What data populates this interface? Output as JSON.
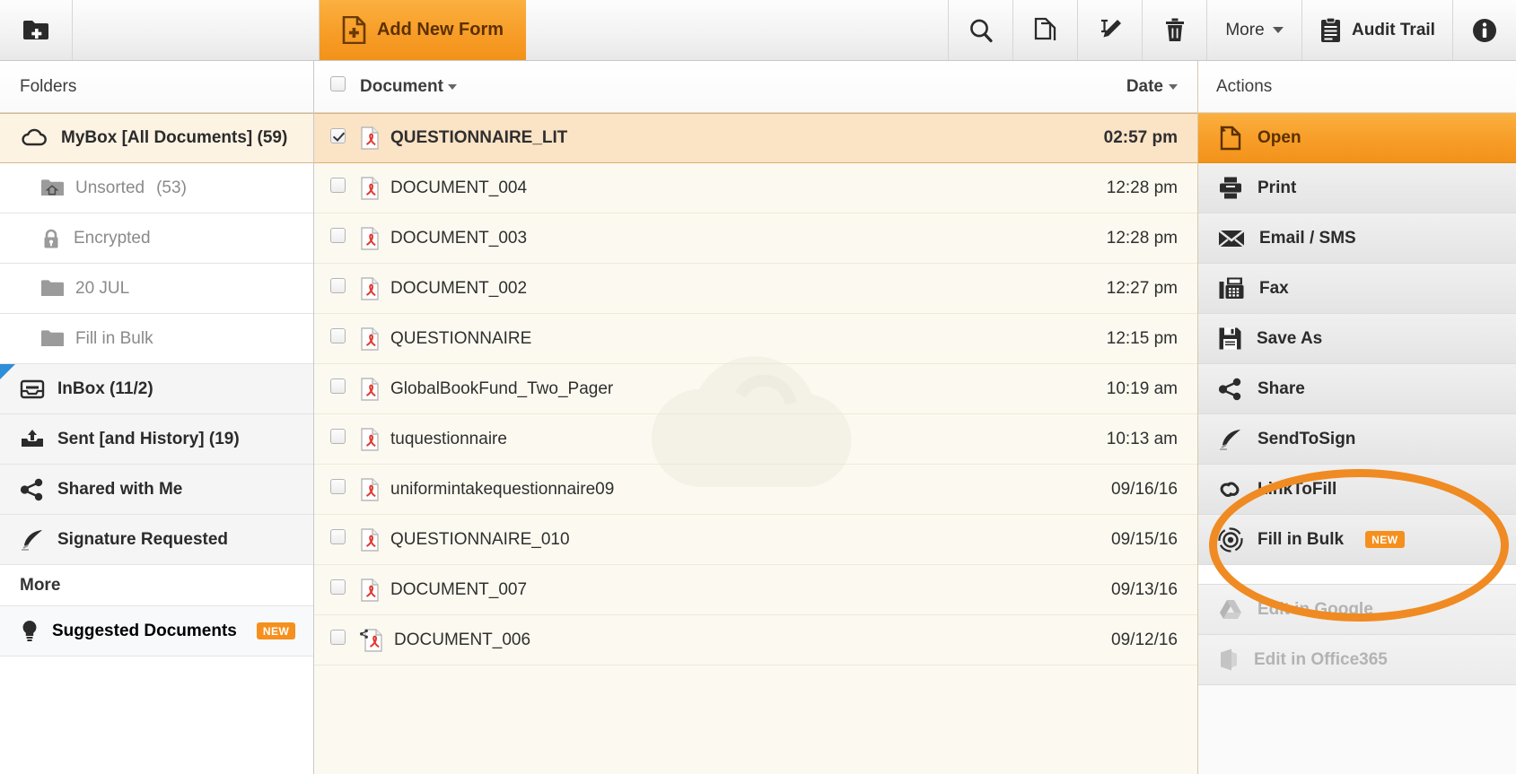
{
  "toolbar": {
    "new_folder_label": "New Folder",
    "new_folder_icon": "folder-plus-icon",
    "add_new_form_label": "Add New Form",
    "add_new_form_icon": "document-plus-icon",
    "search_icon": "search-icon",
    "copy_icon": "copy-icon",
    "rename_icon": "rename-pencil-icon",
    "delete_icon": "trash-icon",
    "more_label": "More",
    "more_icon": "chevron-down-icon",
    "audit_trail_label": "Audit Trail",
    "audit_trail_icon": "clipboard-icon",
    "info_icon": "info-icon"
  },
  "sidebar": {
    "header": "Folders",
    "items": [
      {
        "label": "MyBox [All Documents] (59)",
        "icon": "cloud-icon",
        "type": "root",
        "selected": true
      },
      {
        "label": "Unsorted",
        "count": "(53)",
        "icon": "folder-home-icon",
        "type": "sub"
      },
      {
        "label": "Encrypted",
        "count": "",
        "icon": "lock-icon",
        "type": "sub"
      },
      {
        "label": "20 JUL",
        "count": "",
        "icon": "folder-icon",
        "type": "sub"
      },
      {
        "label": "Fill in Bulk",
        "count": "",
        "icon": "folder-icon",
        "type": "sub"
      },
      {
        "label": "InBox (11/2)",
        "icon": "inbox-icon",
        "type": "group",
        "marked": true
      },
      {
        "label": "Sent [and History] (19)",
        "icon": "outbox-icon",
        "type": "group"
      },
      {
        "label": "Shared with Me",
        "icon": "share-icon",
        "type": "group"
      },
      {
        "label": "Signature Requested",
        "icon": "feather-icon",
        "type": "group"
      }
    ],
    "more_label": "More",
    "suggested": {
      "label": "Suggested Documents",
      "icon": "lightbulb-icon",
      "badge": "NEW"
    }
  },
  "doclist": {
    "columns": {
      "document": "Document",
      "date": "Date"
    },
    "select_all_checked": false,
    "sort_indicator": "descending",
    "rows": [
      {
        "name": "QUESTIONNAIRE_LIT",
        "date": "02:57 pm",
        "checked": true,
        "selected": true,
        "icon": "pdf-icon",
        "shared": false
      },
      {
        "name": "DOCUMENT_004",
        "date": "12:28 pm",
        "checked": false,
        "selected": false,
        "icon": "pdf-icon",
        "shared": false
      },
      {
        "name": "DOCUMENT_003",
        "date": "12:28 pm",
        "checked": false,
        "selected": false,
        "icon": "pdf-icon",
        "shared": false
      },
      {
        "name": "DOCUMENT_002",
        "date": "12:27 pm",
        "checked": false,
        "selected": false,
        "icon": "pdf-icon",
        "shared": false
      },
      {
        "name": "QUESTIONNAIRE",
        "date": "12:15 pm",
        "checked": false,
        "selected": false,
        "icon": "pdf-icon",
        "shared": false
      },
      {
        "name": "GlobalBookFund_Two_Pager",
        "date": "10:19 am",
        "checked": false,
        "selected": false,
        "icon": "pdf-icon",
        "shared": false
      },
      {
        "name": "tuquestionnaire",
        "date": "10:13 am",
        "checked": false,
        "selected": false,
        "icon": "pdf-icon",
        "shared": false
      },
      {
        "name": "uniformintakequestionnaire09",
        "date": "09/16/16",
        "checked": false,
        "selected": false,
        "icon": "pdf-icon",
        "shared": false
      },
      {
        "name": "QUESTIONNAIRE_010",
        "date": "09/15/16",
        "checked": false,
        "selected": false,
        "icon": "pdf-icon",
        "shared": false
      },
      {
        "name": "DOCUMENT_007",
        "date": "09/13/16",
        "checked": false,
        "selected": false,
        "icon": "pdf-icon",
        "shared": false
      },
      {
        "name": "DOCUMENT_006",
        "date": "09/12/16",
        "checked": false,
        "selected": false,
        "icon": "pdf-icon",
        "shared": true
      }
    ],
    "watermark_icon": "cloud-watermark"
  },
  "actions": {
    "header": "Actions",
    "items": [
      {
        "label": "Open",
        "icon": "open-document-icon",
        "state": "active"
      },
      {
        "label": "Print",
        "icon": "printer-icon",
        "state": "normal"
      },
      {
        "label": "Email / SMS",
        "icon": "envelope-icon",
        "state": "normal"
      },
      {
        "label": "Fax",
        "icon": "fax-icon",
        "state": "normal"
      },
      {
        "label": "Save As",
        "icon": "floppy-disk-icon",
        "state": "normal"
      },
      {
        "label": "Share",
        "icon": "share-icon",
        "state": "normal"
      },
      {
        "label": "SendToSign",
        "icon": "feather-icon",
        "state": "normal"
      },
      {
        "label": "LinkToFill",
        "icon": "link-icon",
        "state": "normal"
      },
      {
        "label": "Fill in Bulk",
        "icon": "bulk-gear-icon",
        "state": "normal",
        "badge": "NEW"
      },
      {
        "label": "Edit in Google",
        "icon": "google-drive-icon",
        "state": "disabled"
      },
      {
        "label": "Edit in Office365",
        "icon": "office-icon",
        "state": "disabled"
      }
    ],
    "highlight": {
      "shape": "ellipse",
      "color": "#ef8b22"
    }
  },
  "colors": {
    "accent_orange": "#f5901e",
    "selected_row": "#fbe3c6",
    "list_background": "#fcfaf0",
    "marker_blue": "#2e8ed8"
  }
}
